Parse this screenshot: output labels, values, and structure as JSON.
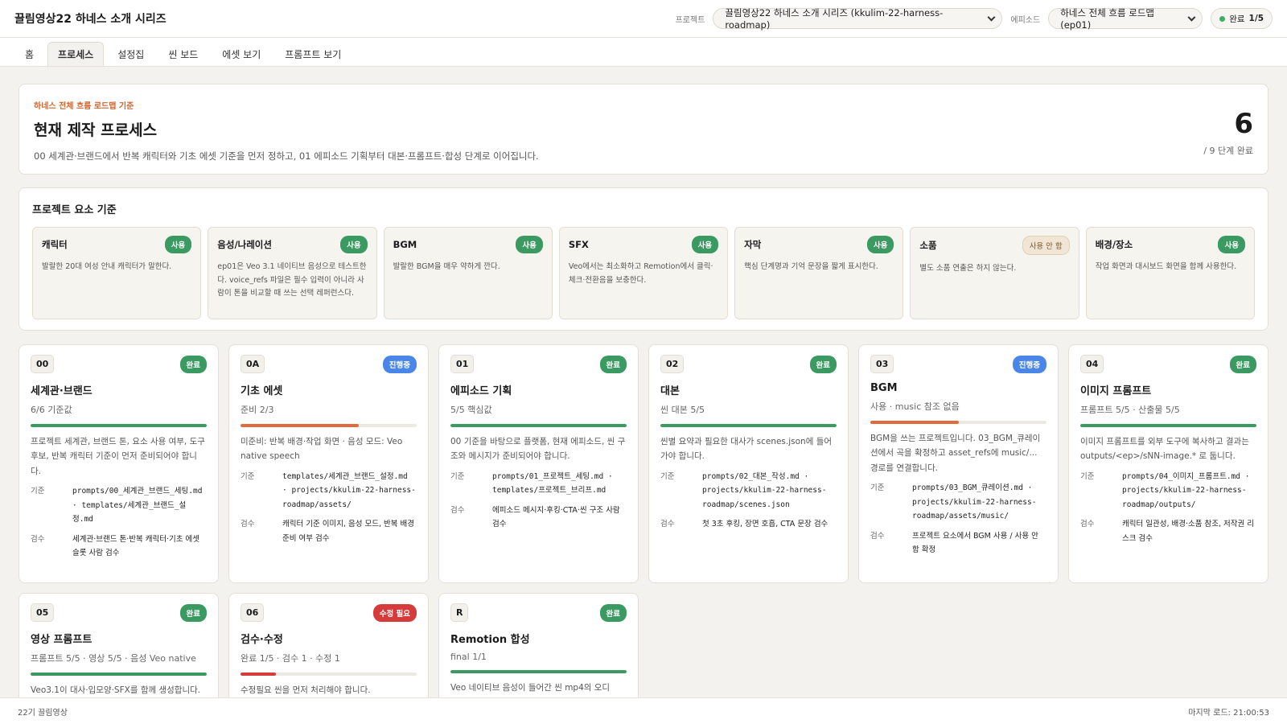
{
  "header": {
    "title": "끌림영상22 하네스 소개 시리즈",
    "project_label": "프로젝트",
    "project_value": "끌림영상22 하네스 소개 시리즈 (kkulim-22-harness-roadmap)",
    "episode_label": "에피소드",
    "episode_value": "하네스 전체 흐름 로드맵 (ep01)",
    "status_label": "완료",
    "status_count": "1/5"
  },
  "tabs": [
    "홈",
    "프로세스",
    "설정집",
    "씬 보드",
    "에셋 보기",
    "프롬프트 보기"
  ],
  "hero": {
    "kicker": "하네스 전체 흐름 로드맵 기준",
    "title": "현재 제작 프로세스",
    "desc": "00 세계관·브랜드에서 반복 캐릭터와 기초 에셋 기준을 먼저 정하고, 01 에피소드 기획부터 대본·프롬프트·합성 단계로 이어집니다.",
    "count": "6",
    "count_sub": "/ 9 단계 완료"
  },
  "elements": {
    "title": "프로젝트 요소 기준",
    "items": [
      {
        "name": "캐릭터",
        "badge": "사용",
        "desc": "발랄한 20대 여성 안내 캐릭터가 말한다."
      },
      {
        "name": "음성/나레이션",
        "badge": "사용",
        "desc": "ep01은 Veo 3.1 네이티브 음성으로 테스트한다. voice_refs 파일은 필수 입력이 아니라 사람이 톤을 비교할 때 쓰는 선택 레퍼런스다."
      },
      {
        "name": "BGM",
        "badge": "사용",
        "desc": "발랄한 BGM을 매우 약하게 깐다."
      },
      {
        "name": "SFX",
        "badge": "사용",
        "desc": "Veo에서는 최소화하고 Remotion에서 클릭·체크·전환음을 보충한다."
      },
      {
        "name": "자막",
        "badge": "사용",
        "desc": "핵심 단계명과 기억 문장을 짧게 표시한다."
      },
      {
        "name": "소품",
        "badge": "사용 안 함",
        "desc": "별도 소품 연출은 하지 않는다."
      },
      {
        "name": "배경/장소",
        "badge": "사용",
        "desc": "작업 화면과 대시보드 화면을 함께 사용한다."
      }
    ]
  },
  "labels": {
    "basis": "기준",
    "review": "검수"
  },
  "process": [
    {
      "code": "00",
      "status": "완료",
      "title": "세계관·브랜드",
      "meta": "6/6 기준값",
      "progress": 1.0,
      "desc": "프로젝트 세계관, 브랜드 톤, 요소 사용 여부, 도구 후보, 반복 캐릭터 기준이 먼저 준비되어야 합니다.",
      "basis": "prompts/00_세계관_브랜드_세팅.md · templates/세계관_브랜드_설정.md",
      "review": "세계관·브랜드 톤·반복 캐릭터·기초 에셋 슬롯 사람 검수"
    },
    {
      "code": "0A",
      "status": "진행중",
      "title": "기초 에셋",
      "meta": "준비 2/3",
      "progress": 0.67,
      "desc": "미준비: 반복 배경·작업 화면 · 음성 모드: Veo native speech",
      "basis": "templates/세계관_브랜드_설정.md · projects/kkulim-22-harness-roadmap/assets/",
      "review": "캐릭터 기준 이미지, 음성 모드, 반복 배경 준비 여부 검수"
    },
    {
      "code": "01",
      "status": "완료",
      "title": "에피소드 기획",
      "meta": "5/5 핵심값",
      "progress": 1.0,
      "desc": "00 기준을 바탕으로 플랫폼, 현재 에피소드, 씬 구조와 메시지가 준비되어야 합니다.",
      "basis": "prompts/01_프로젝트_세팅.md · templates/프로젝트_브리프.md",
      "review": "에피소드 메시지·후킹·CTA·씬 구조 사람 검수"
    },
    {
      "code": "02",
      "status": "완료",
      "title": "대본",
      "meta": "씬 대본 5/5",
      "progress": 1.0,
      "desc": "씬별 요약과 필요한 대사가 scenes.json에 들어가야 합니다.",
      "basis": "prompts/02_대본_작성.md · projects/kkulim-22-harness-roadmap/scenes.json",
      "review": "첫 3초 후킹, 장면 호흡, CTA 문장 검수"
    },
    {
      "code": "03",
      "status": "진행중",
      "title": "BGM",
      "meta": "사용 · music 참조 없음",
      "progress": 0.5,
      "desc": "BGM을 쓰는 프로젝트입니다. 03_BGM_큐레이션에서 곡을 확정하고 asset_refs에 music/... 경로를 연결합니다.",
      "basis": "prompts/03_BGM_큐레이션.md · projects/kkulim-22-harness-roadmap/assets/music/",
      "review": "프로젝트 요소에서 BGM 사용 / 사용 안 함 확정"
    },
    {
      "code": "04",
      "status": "완료",
      "title": "이미지 프롬프트",
      "meta": "프롬프트 5/5 · 산출물 5/5",
      "progress": 1.0,
      "desc": "이미지 프롬프트를 외부 도구에 복사하고 결과는 outputs/<ep>/sNN-image.* 로 둡니다.",
      "basis": "prompts/04_이미지_프롬프트.md · projects/kkulim-22-harness-roadmap/outputs/",
      "review": "캐릭터 일관성, 배경·소품 참조, 저작권 리스크 검수"
    },
    {
      "code": "05",
      "status": "완료",
      "title": "영상 프롬프트",
      "meta": "프롬프트 5/5 · 영상 5/5 · 음성 Veo native",
      "progress": 1.0,
      "desc": "Veo3.1이 대사·입모양·SFX를 함께 생성합니다."
    },
    {
      "code": "06",
      "status": "수정 필요",
      "title": "검수·수정",
      "meta": "완료 1/5 · 검수 1 · 수정 1",
      "progress": 0.2,
      "desc": "수정필요 씬을 먼저 처리해야 합니다."
    },
    {
      "code": "R",
      "status": "완료",
      "title": "Remotion 합성",
      "meta": "final 1/1",
      "progress": 1.0,
      "desc": "Veo 네이티브 음성이 들어간 씬 mp4의 오디"
    }
  ],
  "footer": {
    "left": "22기 끌림영상",
    "right": "마지막 로드: 21:00:53"
  },
  "colors": {
    "done": "#3b9a62",
    "progress": "#4a86e8",
    "fix": "#d63b3b",
    "partial_fill": "#e06a3b",
    "accent": "#d0632b"
  },
  "icons": {
    "status_dot": "status-dot-icon",
    "dropdown": "chevron-down-icon"
  }
}
